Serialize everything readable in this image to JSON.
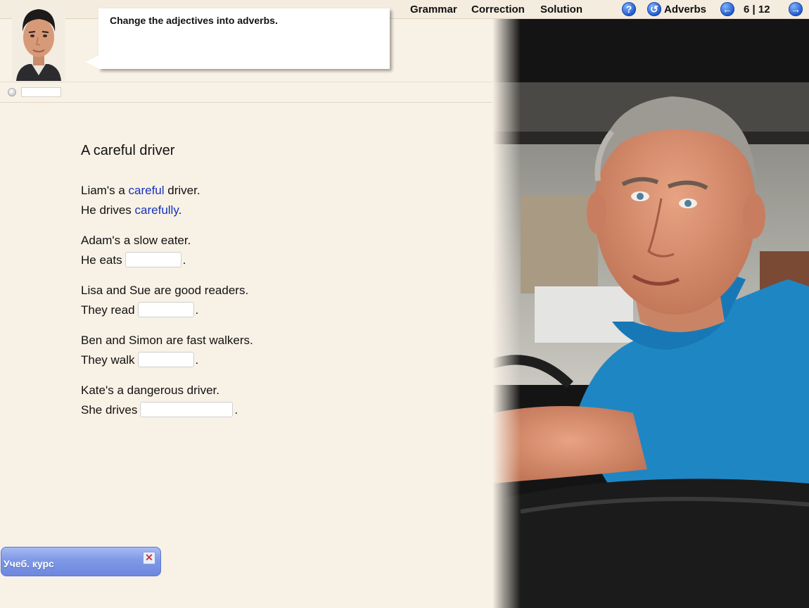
{
  "menu": {
    "grammar": "Grammar",
    "correction": "Correction",
    "solution": "Solution",
    "help_icon": "?",
    "restart_icon": "↺",
    "topic": "Adverbs",
    "prev_icon": "←",
    "page": "6 | 12",
    "next_icon": "→"
  },
  "instruction": "Change the adjectives into adverbs.",
  "exercise": {
    "title": "A careful driver",
    "example": {
      "line1_pre": "Liam's a ",
      "line1_adj": "careful",
      "line1_post": " driver.",
      "line2_pre": "He drives ",
      "line2_adv": "carefully",
      "line2_post": "."
    },
    "items": [
      {
        "sentence": "Adam's a slow eater.",
        "prompt": "He eats",
        "answer": "",
        "end": "."
      },
      {
        "sentence": "Lisa and Sue are good readers.",
        "prompt": "They read",
        "answer": "",
        "end": "."
      },
      {
        "sentence": "Ben and Simon are fast walkers.",
        "prompt": "They walk",
        "answer": "",
        "end": "."
      },
      {
        "sentence": "Kate's a dangerous driver.",
        "prompt": "She drives",
        "answer": "",
        "end": "."
      }
    ]
  },
  "taskbar": {
    "label": "Учеб. курс",
    "close_icon": "✕"
  },
  "colors": {
    "background": "#f8f1e6",
    "highlight": "#1533b9",
    "button_blue": "#1f58c8"
  }
}
